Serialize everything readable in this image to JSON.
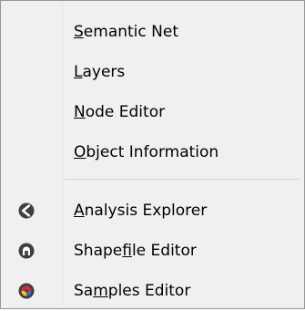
{
  "menu": {
    "items": [
      {
        "key": "semantic-net",
        "parts": [
          "",
          "S",
          "emantic Net"
        ],
        "icon": null
      },
      {
        "key": "layers",
        "parts": [
          "",
          "L",
          "ayers"
        ],
        "icon": null
      },
      {
        "key": "node-editor",
        "parts": [
          "",
          "N",
          "ode Editor"
        ],
        "icon": null
      },
      {
        "key": "object-information",
        "parts": [
          "",
          "O",
          "bject Information"
        ],
        "icon": null
      },
      {
        "key": "analysis-explorer",
        "parts": [
          "",
          "A",
          "nalysis Explorer"
        ],
        "icon": "analysis-explorer-icon"
      },
      {
        "key": "shapefile-editor",
        "parts": [
          "Shape",
          "f",
          "ile Editor"
        ],
        "icon": "shapefile-editor-icon"
      },
      {
        "key": "samples-editor",
        "parts": [
          "Sa",
          "m",
          "ples Editor"
        ],
        "icon": "samples-editor-icon"
      }
    ]
  },
  "colors": {
    "menu_background": "#f0f0f0",
    "menu_border": "#979797",
    "text": "#000000",
    "icon_dark": "#3f3f3f",
    "samples_icon_red": "#d62d2d",
    "samples_icon_yellow": "#f2c418",
    "samples_icon_blue": "#2f6fd0"
  }
}
